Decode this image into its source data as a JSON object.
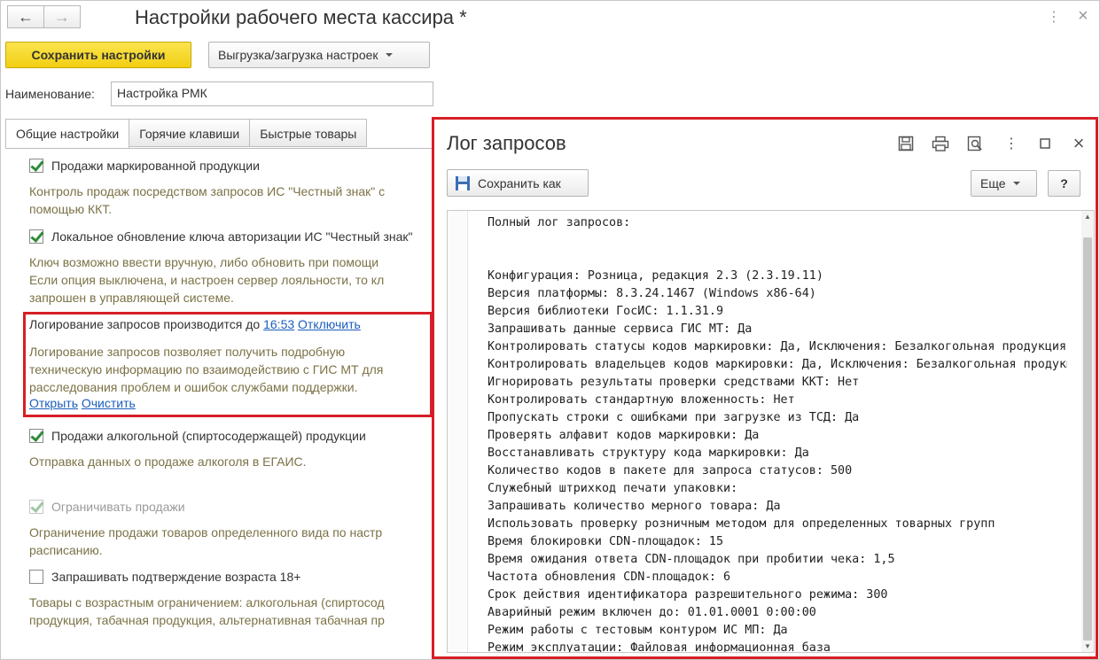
{
  "window": {
    "title": "Настройки рабочего места кассира *",
    "back_icon": "←",
    "forward_icon": "→",
    "more_icon": "⋮",
    "close_icon": "×"
  },
  "toolbar": {
    "save_label": "Сохранить настройки",
    "export_label": "Выгрузка/загрузка настроек"
  },
  "name_field": {
    "label": "Наименование:",
    "value": "Настройка РМК"
  },
  "tabs": [
    {
      "label": "Общие настройки",
      "active": true
    },
    {
      "label": "Горячие клавиши",
      "active": false
    },
    {
      "label": "Быстрые товары",
      "active": false
    }
  ],
  "settings": {
    "marked": {
      "label": "Продажи маркированной продукции",
      "checked": true,
      "desc": [
        "Контроль продаж посредством запросов ИС \"Честный знак\" с",
        "помощью ККТ."
      ]
    },
    "local_key": {
      "label": "Локальное обновление ключа авторизации ИС \"Честный знак\"",
      "checked": true,
      "desc": [
        "Ключ возможно ввести вручную, либо обновить при помощи",
        "Если опция выключена, и настроен сервер лояльности, то кл",
        "запрошен в управляющей системе."
      ]
    },
    "logging": {
      "text": "Логирование запросов производится до",
      "time_link": "16:53",
      "disable_link": "Отключить",
      "desc": [
        "Логирование запросов позволяет получить подробную",
        "техническую информацию по взаимодействию с ГИС МТ для",
        "расследования проблем и ошибок службами поддержки."
      ],
      "open_link": "Открыть",
      "clear_link": "Очистить"
    },
    "alcohol": {
      "label": "Продажи алкогольной (спиртосодержащей) продукции",
      "checked": true,
      "desc": [
        "Отправка данных о продаже алкоголя в ЕГАИС."
      ]
    },
    "restrict": {
      "label": "Ограничивать продажи",
      "checked": true,
      "disabled": true,
      "desc": [
        "Ограничение продажи товаров определенного вида по настр",
        "расписанию."
      ]
    },
    "age": {
      "label": "Запрашивать подтверждение возраста 18+",
      "checked": false,
      "desc": [
        "Товары с возрастным ограничением: алкогольная (спиртосод",
        "продукция, табачная продукция, альтернативная табачная пр"
      ]
    }
  },
  "log_dialog": {
    "title": "Лог запросов",
    "save_as_label": "Сохранить как",
    "more_label": "Еще",
    "help_label": "?",
    "icons": [
      "save-icon",
      "print-icon",
      "preview-icon",
      "more-icon",
      "maximize-icon",
      "close-icon"
    ],
    "lines": [
      "Полный лог запросов:",
      "",
      "",
      "Конфигурация: Розница, редакция 2.3 (2.3.19.11)",
      "Версия платформы: 8.3.24.1467 (Windows x86-64)",
      "Версия библиотеки ГосИС: 1.1.31.9",
      "Запрашивать данные сервиса ГИС МТ: Да",
      "Контролировать статусы кодов маркировки: Да, Исключения: Безалкогольная продукция",
      "Контролировать владельцев кодов маркировки: Да, Исключения: Безалкогольная продукция",
      "Игнорировать результаты проверки средствами ККТ: Нет",
      "Контролировать стандартную вложенность: Нет",
      "Пропускать строки с ошибками при загрузке из ТСД: Да",
      "Проверять алфавит кодов маркировки: Да",
      "Восстанавливать структуру кода маркировки: Да",
      "Количество кодов в пакете для запроса статусов: 500",
      "Служебный штрихкод печати упаковки:",
      "Запрашивать количество мерного товара: Да",
      "Использовать проверку розничным методом для определенных товарных групп",
      "Время блокировки CDN-площадок: 15",
      "Время ожидания ответа CDN-площадок при пробитии чека: 1,5",
      "Частота обновления CDN-площадок: 6",
      "Срок действия идентификатора разрешительного режима: 300",
      "Аварийный режим включен до: 01.01.0001 0:00:00",
      "Режим работы с тестовым контуром ИС МП: Да",
      "Режим эксплуатации: Файловая информационная база"
    ]
  },
  "colors": {
    "accent_yellow": "#f5d315",
    "highlight_red": "#d61f26",
    "link_blue": "#1b5dbf",
    "desc_text": "#7b7246"
  }
}
